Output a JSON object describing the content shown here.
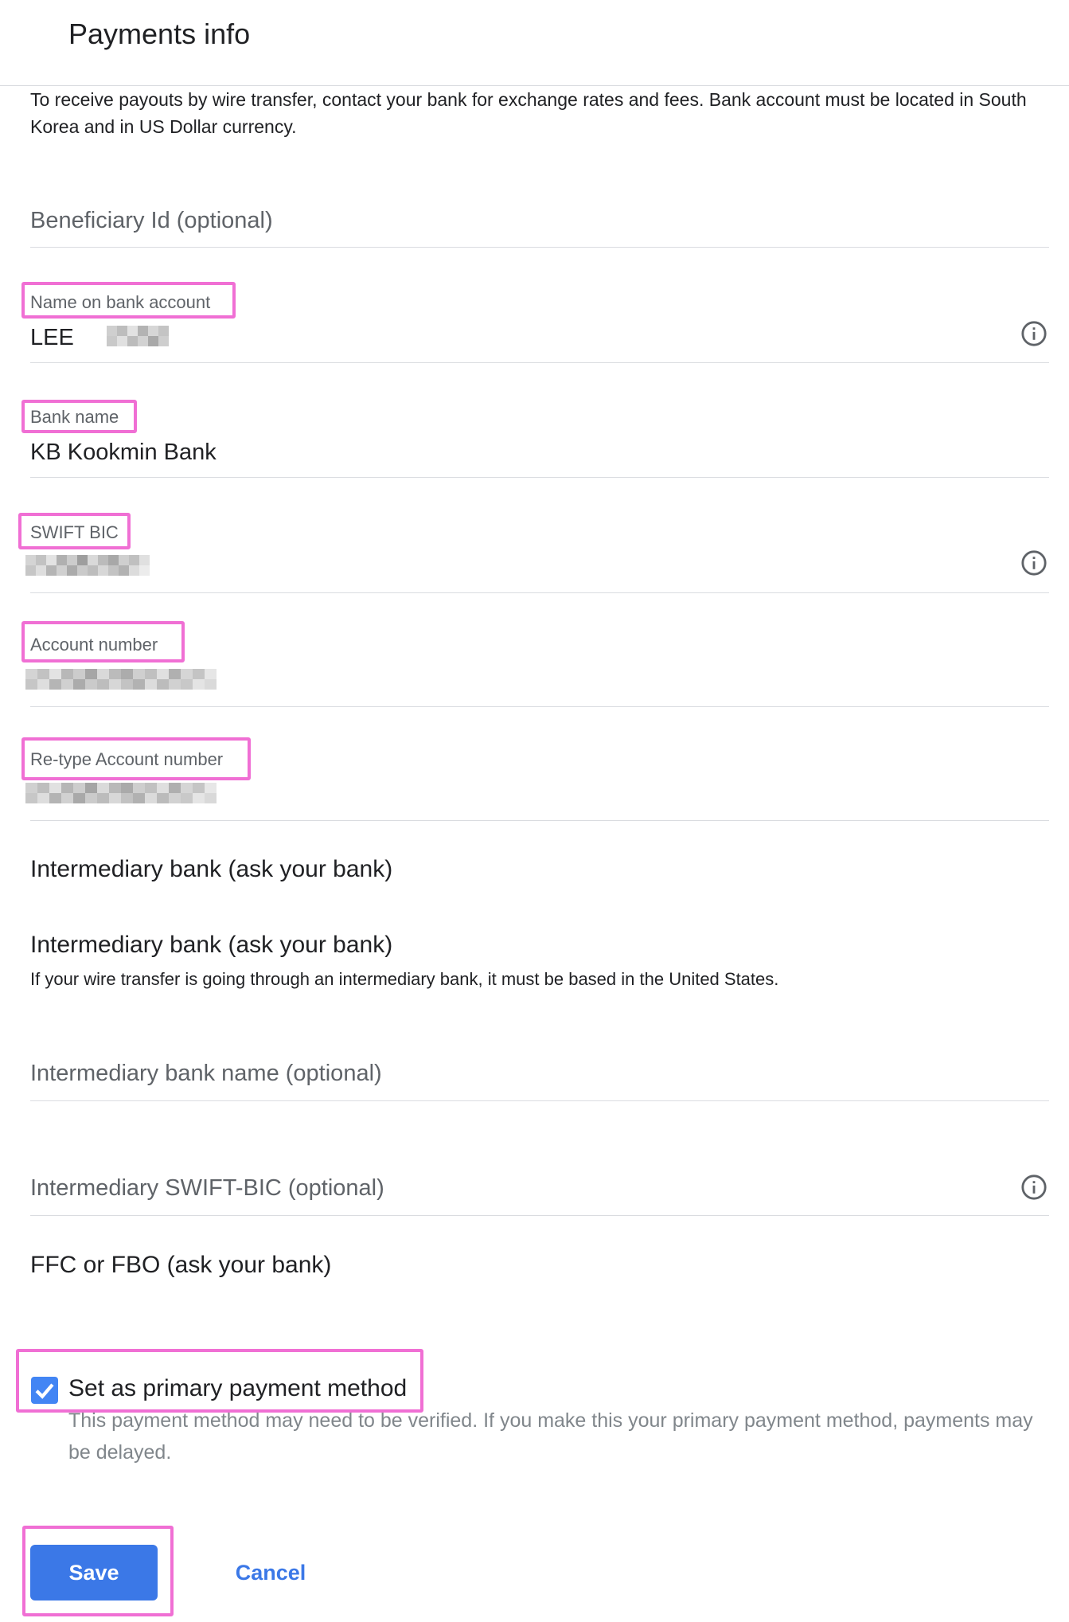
{
  "header": {
    "title": "Payments info"
  },
  "intro_text": "To receive payouts by wire transfer, contact your bank for exchange rates and fees. Bank account must be located in South Korea and in US Dollar currency.",
  "fields": {
    "beneficiary_id": {
      "placeholder": "Beneficiary Id (optional)"
    },
    "name_on_account": {
      "label": "Name on bank account",
      "value": "LEE",
      "icon": "info-icon"
    },
    "bank_name": {
      "label": "Bank name",
      "value": "KB Kookmin Bank"
    },
    "swift_bic": {
      "label": "SWIFT BIC",
      "icon": "info-icon"
    },
    "account_number": {
      "label": "Account number"
    },
    "retype_account_number": {
      "label": "Re-type Account number"
    }
  },
  "intermediary": {
    "heading_1": "Intermediary bank (ask your bank)",
    "heading_2": "Intermediary bank (ask your bank)",
    "helper": "If your wire transfer is going through an intermediary bank, it must be based in the United States.",
    "bank_name_placeholder": "Intermediary bank name (optional)",
    "swift_placeholder": "Intermediary SWIFT-BIC (optional)",
    "swift_icon": "info-icon"
  },
  "ffc_heading": "FFC or FBO (ask your bank)",
  "primary": {
    "label": "Set as primary payment method",
    "checked": true,
    "help": "This payment method may need to be verified. If you make this your primary payment method, payments may be delayed."
  },
  "actions": {
    "save_label": "Save",
    "cancel_label": "Cancel"
  },
  "colors": {
    "accent": "#3b78e7",
    "highlight": "#f06fd4",
    "divider": "#dadce0",
    "muted_text": "#5f6368"
  }
}
